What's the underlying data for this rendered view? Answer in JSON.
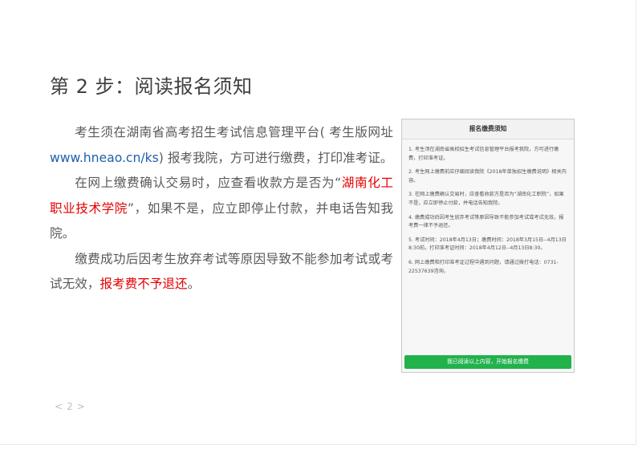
{
  "heading": "第 2 步：阅读报名须知",
  "paragraph1": {
    "before": "考生须在湖南省高考招生考试信息管理平台( 考生版网址",
    "url": "www.hneao.cn/ks",
    "after": ") 报考我院，方可进行缴费，打印准考证。"
  },
  "paragraph2": {
    "before": "在网上缴费确认交易时，应查看收款方是否为",
    "highlight": "湖南化工职业技术学院",
    "after": "，如果不是，应立即停止付款，并电话告知我院。"
  },
  "paragraph3": {
    "before": "缴费成功后因考生放弃考试等原因导致不能参加考试或考试无效，",
    "highlight": "报考费不予退还",
    "after": "。"
  },
  "notice": {
    "title": "报名缴费须知",
    "items": [
      "1. 考生须在湖南省高校招生考试信息管理平台报考我院，方可进行缴费，打印准考证。",
      "2. 考生网上缴费前应仔细阅读我院《2018年单独招生缴费说明》相关内容。",
      "3. 在网上缴费确认交易时，应查看收款方是否为“湖南化工职院”，如果不是，应立即停止付款，并电话告知我院。",
      "4. 缴费成功后因考生放弃考试等原因导致不能参加考试或考试无效，报考费一律不予退还。",
      "5. 考试时间：2018年4月13日；缴费时间：2018年3月15日--4月13日8:30前。打印准考证时间：2018年4月12日--4月13日8:30。",
      "6. 网上缴费和打印准考证过程中遇到问题，请通过拨打电话：0731-22537639咨询。"
    ],
    "button_label": "我已阅读以上内容，开始报名缴费"
  },
  "pager": {
    "prev": "<",
    "page": "2",
    "next": ">"
  }
}
